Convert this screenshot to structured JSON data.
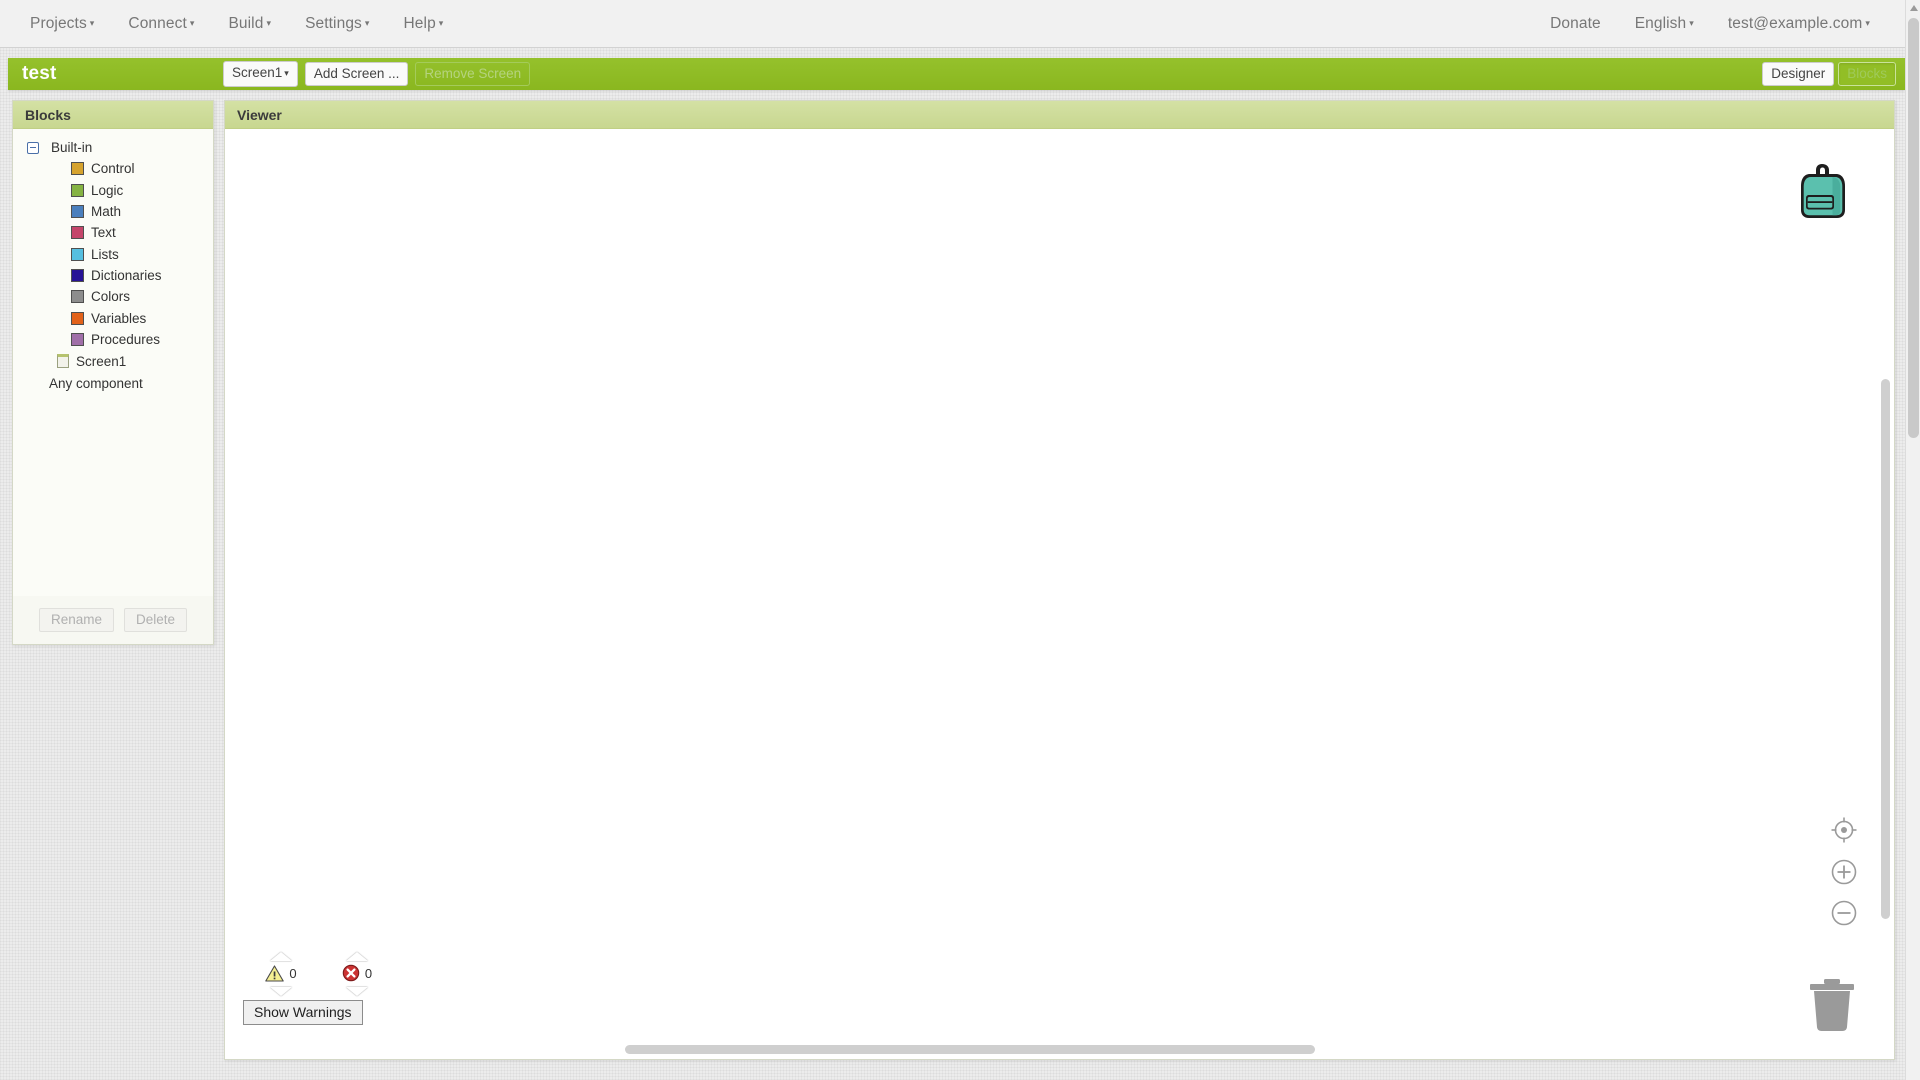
{
  "topbar": {
    "menus": [
      {
        "label": "Projects",
        "caret": "▾"
      },
      {
        "label": "Connect",
        "caret": "▾"
      },
      {
        "label": "Build",
        "caret": "▾"
      },
      {
        "label": "Settings",
        "caret": "▾"
      },
      {
        "label": "Help",
        "caret": "▾"
      }
    ],
    "right": [
      {
        "label": "Donate",
        "caret": ""
      },
      {
        "label": "English",
        "caret": "▾"
      },
      {
        "label": "test@example.com",
        "caret": "▾"
      }
    ]
  },
  "projectbar": {
    "title": "test",
    "screen_selector": "Screen1",
    "screen_selector_caret": "▾",
    "add_screen": "Add Screen ...",
    "remove_screen": "Remove Screen",
    "designer": "Designer",
    "blocks": "Blocks",
    "accent_color": "#8db927"
  },
  "blocks_panel": {
    "header": "Blocks",
    "builtin": "Built-in",
    "categories": [
      {
        "label": "Control",
        "color": "#d6a32e"
      },
      {
        "label": "Logic",
        "color": "#85b342"
      },
      {
        "label": "Math",
        "color": "#4a7fbd"
      },
      {
        "label": "Text",
        "color": "#c4456a"
      },
      {
        "label": "Lists",
        "color": "#56bfe0"
      },
      {
        "label": "Dictionaries",
        "color": "#271296"
      },
      {
        "label": "Colors",
        "color": "#8d8d8d"
      },
      {
        "label": "Variables",
        "color": "#e2621a"
      },
      {
        "label": "Procedures",
        "color": "#a06fa8"
      }
    ],
    "screen": "Screen1",
    "any_component": "Any component",
    "rename": "Rename",
    "delete": "Delete"
  },
  "viewer": {
    "header": "Viewer",
    "warning_count": "0",
    "error_count": "0",
    "show_warnings": "Show Warnings",
    "backpack_color": "#5bc0ae",
    "trash_color": "#9a9a9a"
  }
}
